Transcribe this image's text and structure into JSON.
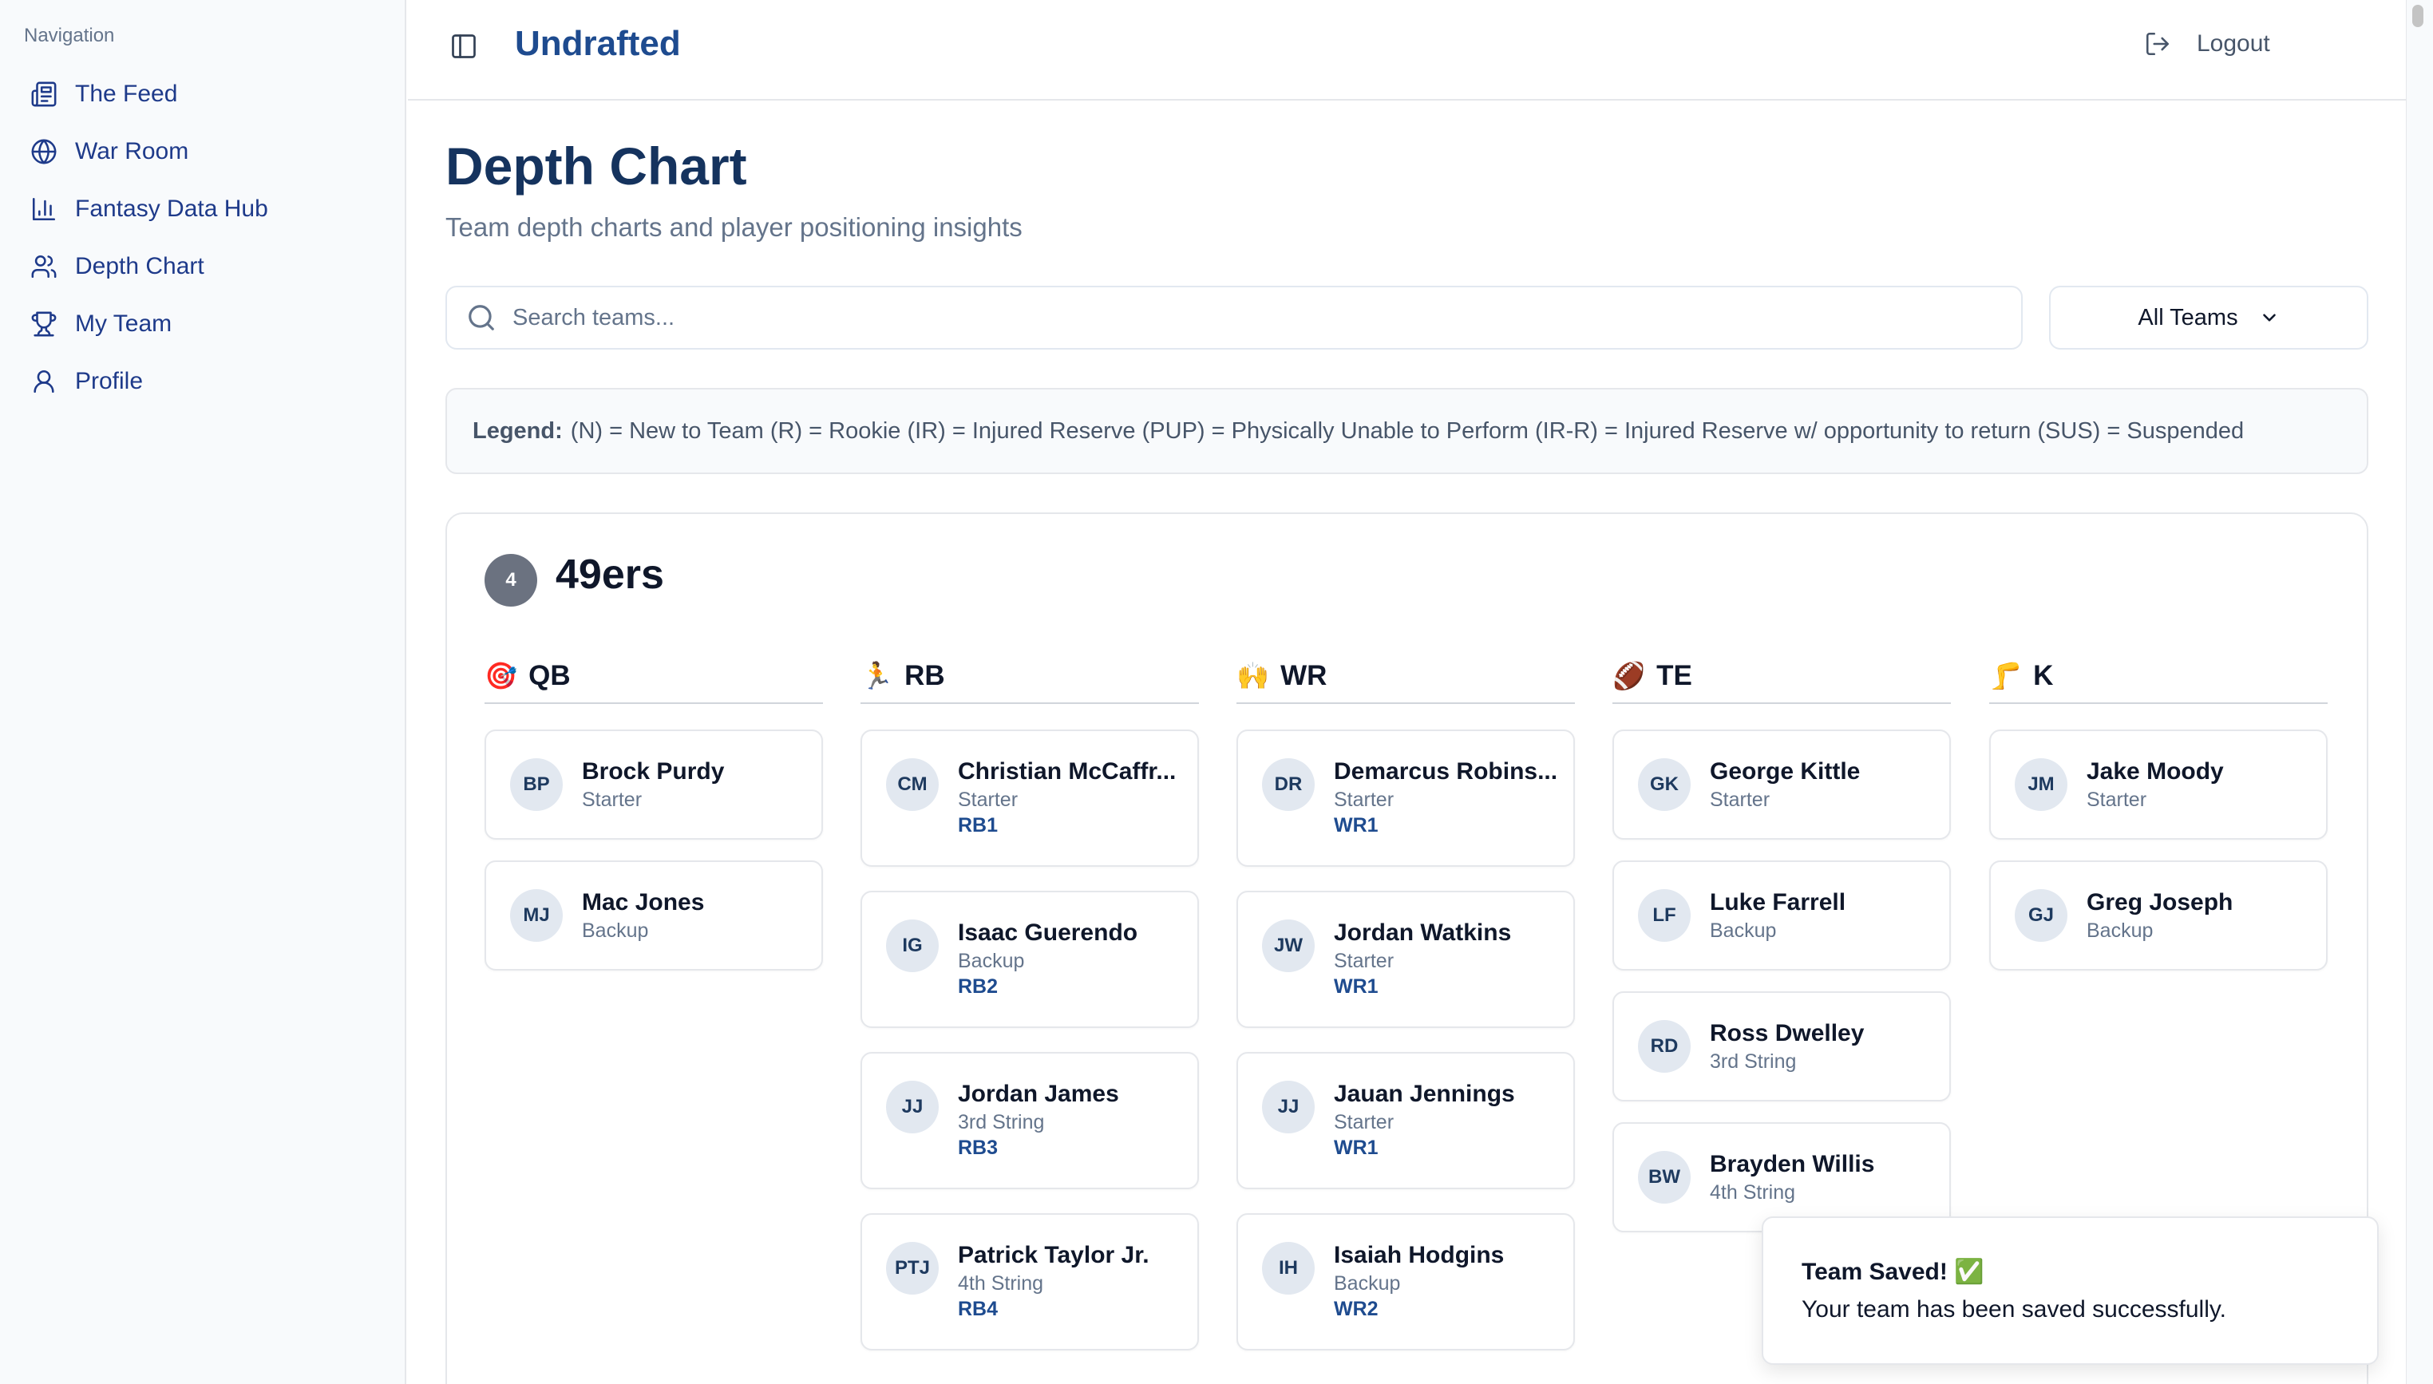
{
  "sidebar": {
    "heading": "Navigation",
    "items": [
      {
        "label": "The Feed",
        "icon": "newspaper-icon"
      },
      {
        "label": "War Room",
        "icon": "globe-icon"
      },
      {
        "label": "Fantasy Data Hub",
        "icon": "bar-chart-icon"
      },
      {
        "label": "Depth Chart",
        "icon": "users-icon"
      },
      {
        "label": "My Team",
        "icon": "trophy-icon"
      },
      {
        "label": "Profile",
        "icon": "user-icon"
      }
    ]
  },
  "header": {
    "brand": "Undrafted",
    "logout_label": "Logout"
  },
  "page": {
    "title": "Depth Chart",
    "subtitle": "Team depth charts and player positioning insights"
  },
  "search": {
    "placeholder": "Search teams..."
  },
  "filter": {
    "selected": "All Teams"
  },
  "legend": {
    "label": "Legend:",
    "text": "(N) = New to Team (R) = Rookie (IR) = Injured Reserve (PUP) = Physically Unable to Perform (IR-R) = Injured Reserve w/ opportunity to return (SUS) = Suspended"
  },
  "team": {
    "rank": "4",
    "name": "49ers",
    "positions": [
      {
        "code": "QB",
        "emoji": "🎯",
        "players": [
          {
            "initials": "BP",
            "name": "Brock Purdy",
            "status": "Starter",
            "slot": ""
          },
          {
            "initials": "MJ",
            "name": "Mac Jones",
            "status": "Backup",
            "slot": ""
          }
        ]
      },
      {
        "code": "RB",
        "emoji": "🏃",
        "players": [
          {
            "initials": "CM",
            "name": "Christian McCaffr...",
            "status": "Starter",
            "slot": "RB1"
          },
          {
            "initials": "IG",
            "name": "Isaac Guerendo",
            "status": "Backup",
            "slot": "RB2"
          },
          {
            "initials": "JJ",
            "name": "Jordan James",
            "status": "3rd String",
            "slot": "RB3"
          },
          {
            "initials": "PTJ",
            "name": "Patrick Taylor Jr.",
            "status": "4th String",
            "slot": "RB4"
          }
        ]
      },
      {
        "code": "WR",
        "emoji": "🙌",
        "players": [
          {
            "initials": "DR",
            "name": "Demarcus Robins...",
            "status": "Starter",
            "slot": "WR1"
          },
          {
            "initials": "JW",
            "name": "Jordan Watkins",
            "status": "Starter",
            "slot": "WR1"
          },
          {
            "initials": "JJ",
            "name": "Jauan Jennings",
            "status": "Starter",
            "slot": "WR1"
          },
          {
            "initials": "IH",
            "name": "Isaiah Hodgins",
            "status": "Backup",
            "slot": "WR2"
          }
        ]
      },
      {
        "code": "TE",
        "emoji": "🏈",
        "players": [
          {
            "initials": "GK",
            "name": "George Kittle",
            "status": "Starter",
            "slot": ""
          },
          {
            "initials": "LF",
            "name": "Luke Farrell",
            "status": "Backup",
            "slot": ""
          },
          {
            "initials": "RD",
            "name": "Ross Dwelley",
            "status": "3rd String",
            "slot": ""
          },
          {
            "initials": "BW",
            "name": "Brayden Willis",
            "status": "4th String",
            "slot": ""
          }
        ]
      },
      {
        "code": "K",
        "emoji": "🦵",
        "players": [
          {
            "initials": "JM",
            "name": "Jake Moody",
            "status": "Starter",
            "slot": ""
          },
          {
            "initials": "GJ",
            "name": "Greg Joseph",
            "status": "Backup",
            "slot": ""
          }
        ]
      }
    ]
  },
  "toast": {
    "title": "Team Saved! ✅",
    "message": "Your team has been saved successfully."
  }
}
